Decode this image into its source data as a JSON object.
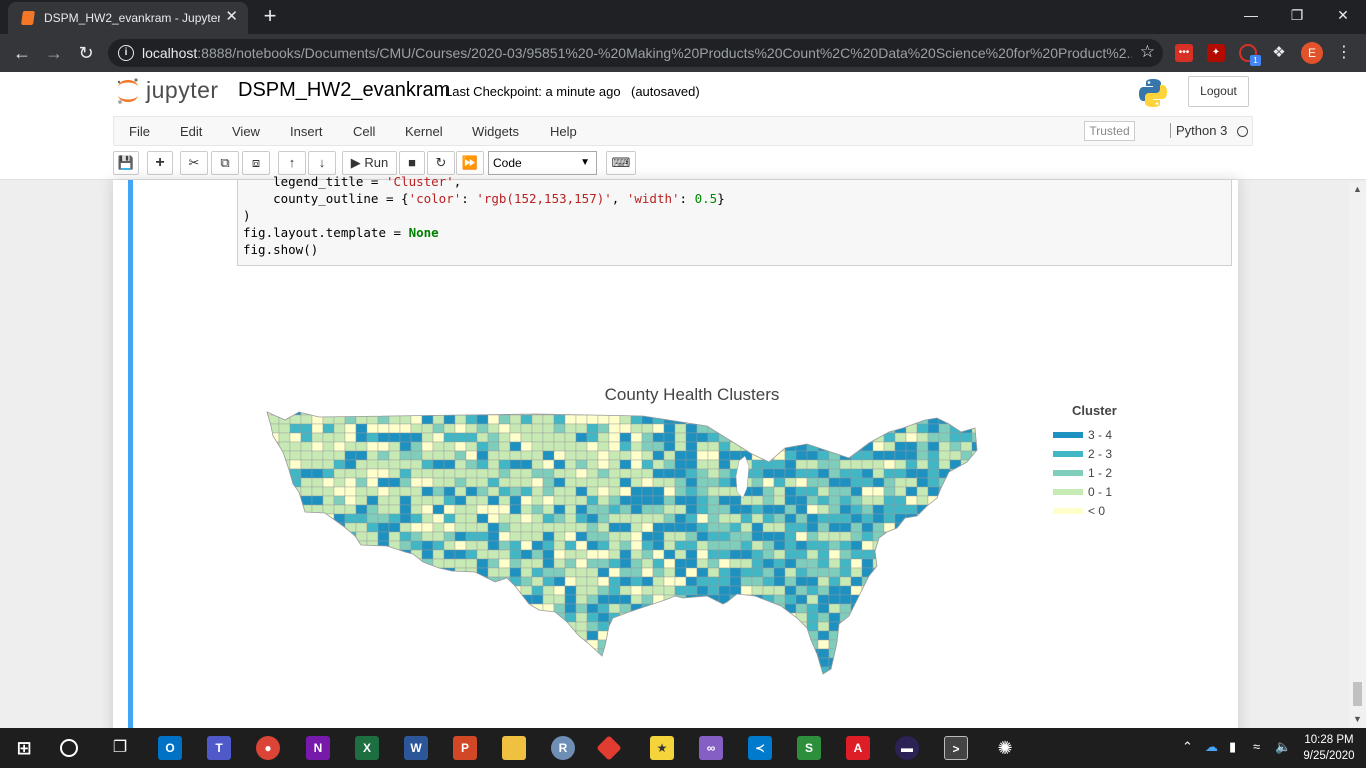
{
  "browser": {
    "tab_title": "DSPM_HW2_evankram - Jupyter",
    "tab_close": "✕",
    "new_tab": "+",
    "url_host": "localhost",
    "url_path": ":8888/notebooks/Documents/CMU/Courses/2020-03/95851%20-%20Making%20Products%20Count%2C%20Data%20Science%20for%20Product%2...",
    "profile_initial": "E",
    "extension_badge": "1"
  },
  "jupyter": {
    "logo_text": "jupyter",
    "notebook_name": "DSPM_HW2_evankram",
    "checkpoint": "Last Checkpoint: a minute ago",
    "autosave": "(autosaved)",
    "logout": "Logout"
  },
  "menu": {
    "items": [
      "File",
      "Edit",
      "View",
      "Insert",
      "Cell",
      "Kernel",
      "Widgets",
      "Help"
    ],
    "trusted": "Trusted",
    "kernel_name": "Python 3"
  },
  "toolbar": {
    "run_label": "Run",
    "cell_type": "Code"
  },
  "code": {
    "line1_pre": "    legend_title = ",
    "line1_str": "'Cluster'",
    "line1_post": ",",
    "line2_pre": "    county_outline = {",
    "line2_k1": "'color'",
    "line2_mid1": ": ",
    "line2_v1": "'rgb(152,153,157)'",
    "line2_mid2": ", ",
    "line2_k2": "'width'",
    "line2_mid3": ": ",
    "line2_v2": "0.5",
    "line2_post": "}",
    "line3": ")",
    "line4_pre": "fig.layout.template = ",
    "line4_kw": "None",
    "line5": "fig.show()"
  },
  "chart_data": {
    "type": "choropleth",
    "title": "County Health Clusters",
    "legend_title": "Cluster",
    "legend_placement": "top-right",
    "categories": [
      "3 - 4",
      "2 - 3",
      "1 - 2",
      "0 - 1",
      "< 0"
    ],
    "colors": [
      "#1d91c0",
      "#41b6c4",
      "#7fcdbb",
      "#c7e9b4",
      "#ffffcc"
    ],
    "county_outline_color": "#98999d"
  },
  "taskbar": {
    "time": "10:28 PM",
    "date": "9/25/2020"
  }
}
